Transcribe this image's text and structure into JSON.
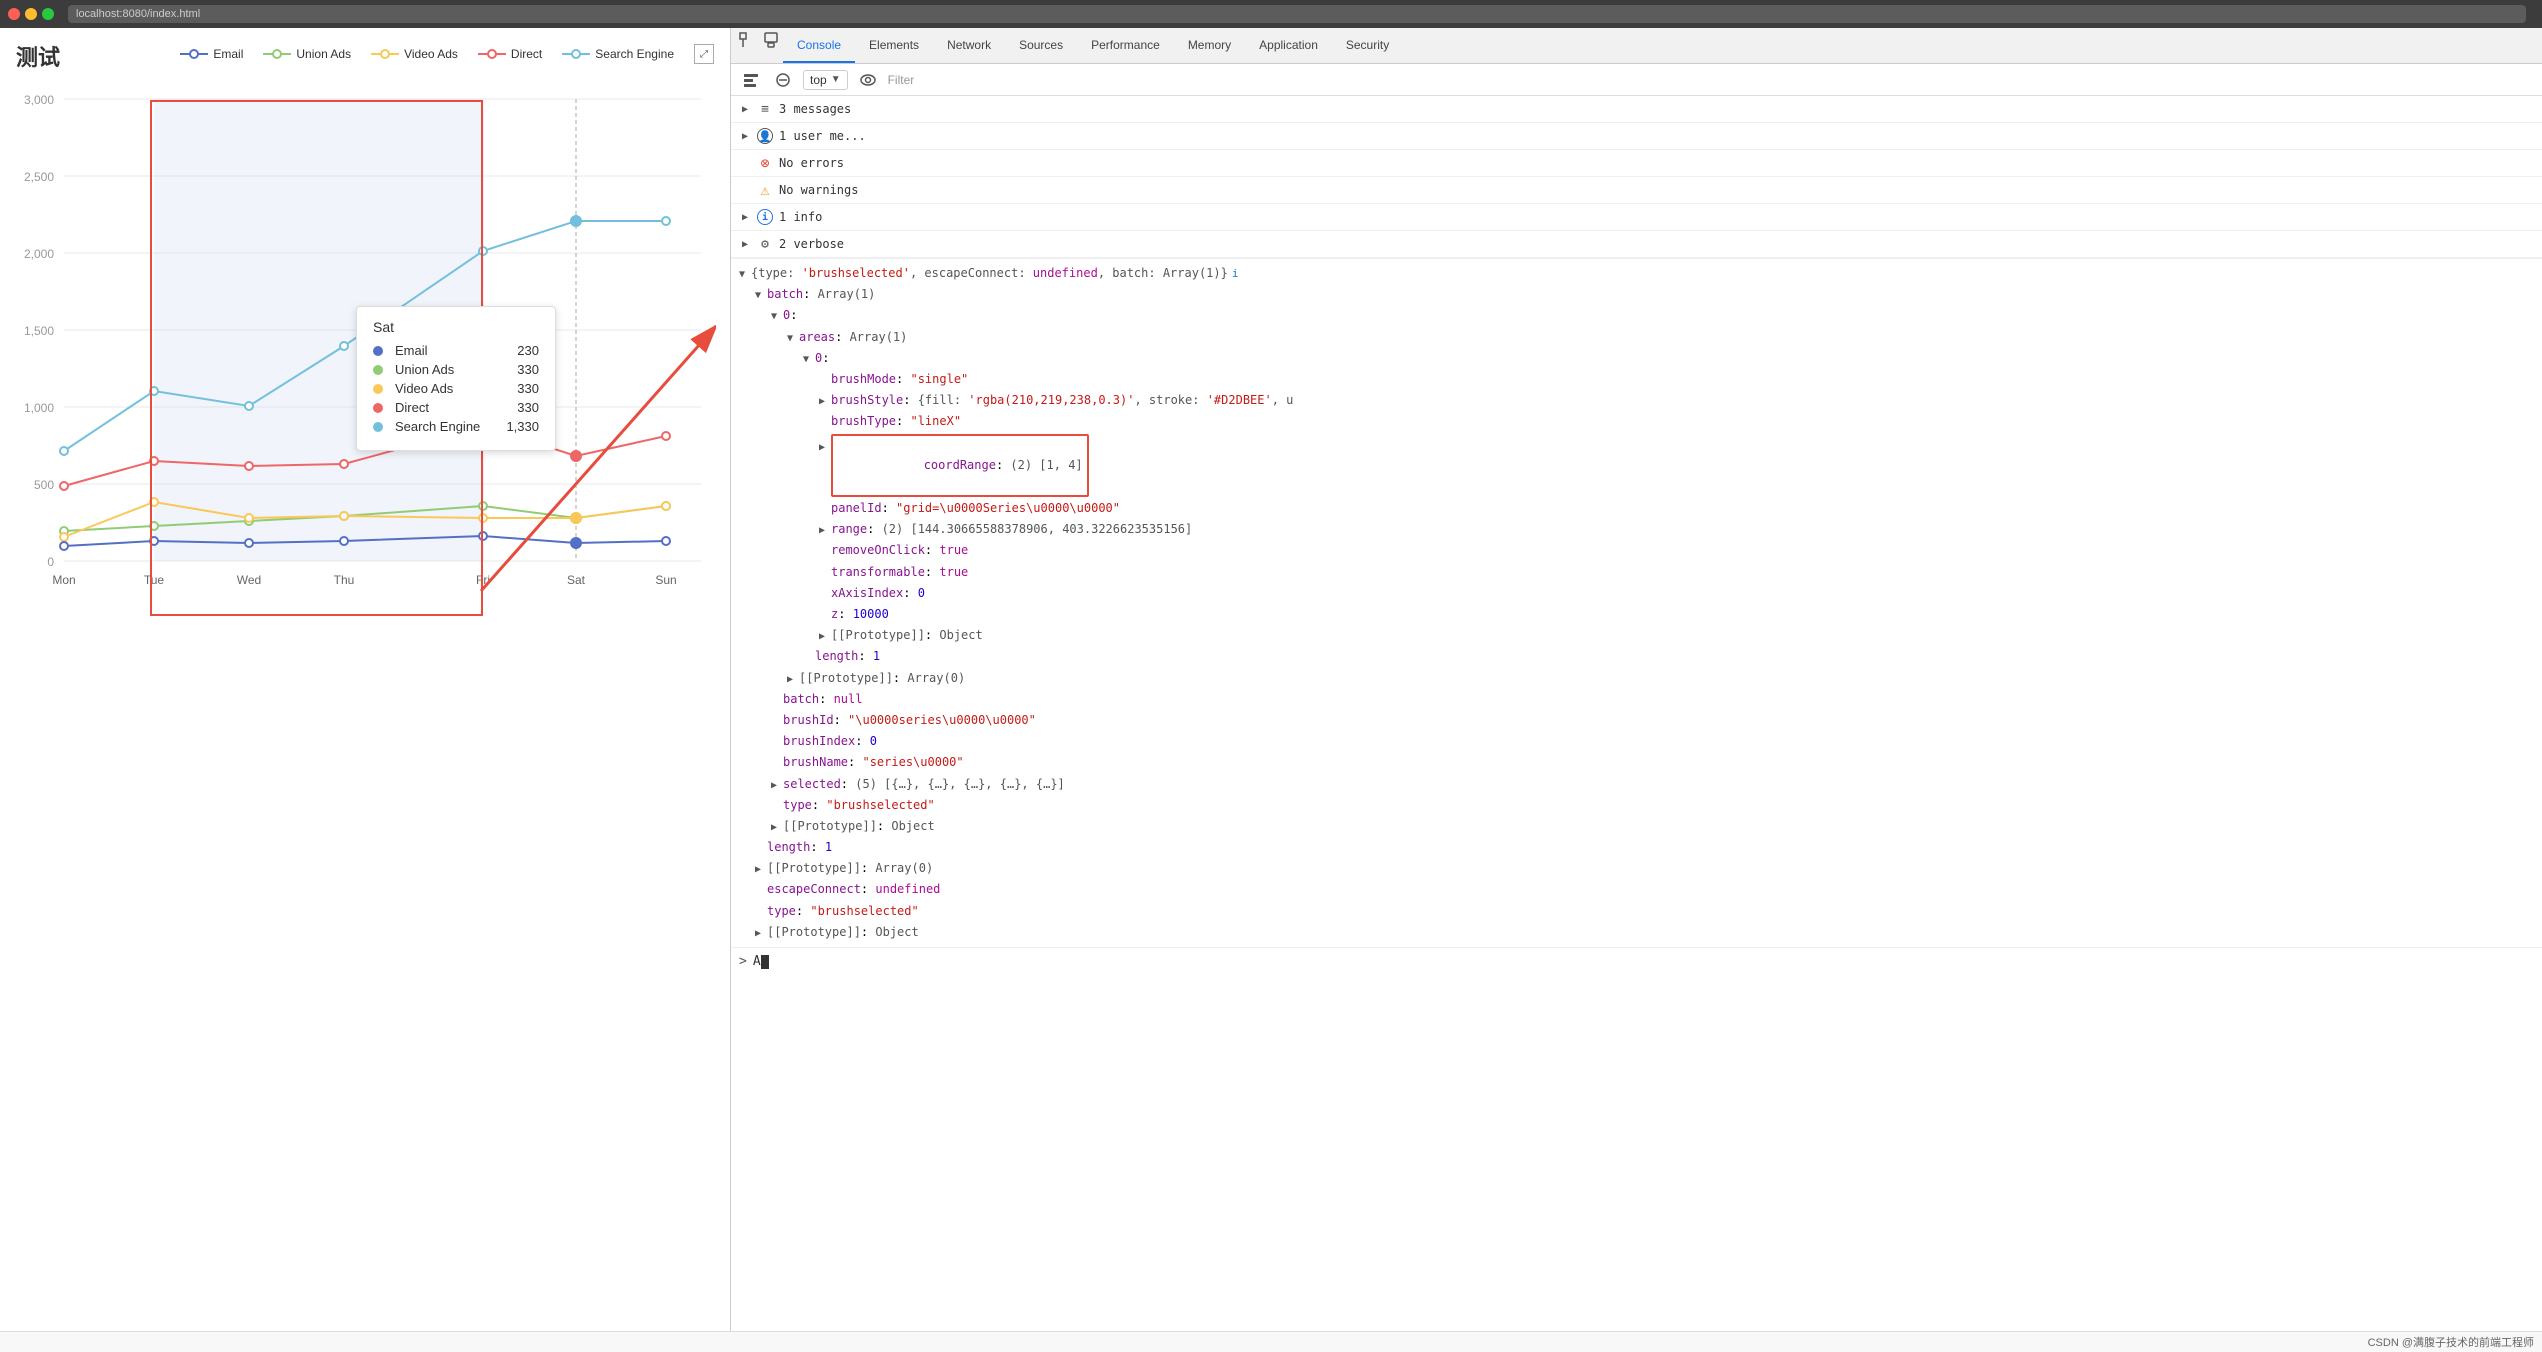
{
  "browser": {
    "url": "localhost:8080/index.html",
    "dots": [
      "#ff5f57",
      "#febc2e",
      "#28c840"
    ]
  },
  "chart": {
    "title": "测试",
    "legend": [
      {
        "label": "Email",
        "color": "#5470c6"
      },
      {
        "label": "Union Ads",
        "color": "#91cc75"
      },
      {
        "label": "Video Ads",
        "color": "#fac858"
      },
      {
        "label": "Direct",
        "color": "#ee6666"
      },
      {
        "label": "Search Engine",
        "color": "#73c0de"
      }
    ],
    "yAxis": [
      "3,000",
      "2,500",
      "2,000",
      "1,500",
      "1,000",
      "500",
      "0"
    ],
    "xAxis": [
      "Mon",
      "Tue",
      "Wed",
      "Thu",
      "Fri",
      "Sat",
      "Sun"
    ],
    "tooltip": {
      "title": "Sat",
      "rows": [
        {
          "label": "Email",
          "color": "#5470c6",
          "value": "230"
        },
        {
          "label": "Union Ads",
          "color": "#91cc75",
          "value": "330"
        },
        {
          "label": "Video Ads",
          "color": "#fac858",
          "value": "330"
        },
        {
          "label": "Direct",
          "color": "#ee6666",
          "value": "330"
        },
        {
          "label": "Search Engine",
          "color": "#73c0de",
          "value": "1,330"
        }
      ]
    }
  },
  "devtools": {
    "tabs": [
      "Console",
      "Elements",
      "Network",
      "Sources",
      "Performance",
      "Memory",
      "Application",
      "Security"
    ],
    "active_tab": "Console",
    "toolbar": {
      "top_label": "top",
      "filter_placeholder": "Filter"
    },
    "messages": [
      {
        "type": "list",
        "text": "3 messages",
        "icon": "list"
      },
      {
        "type": "user",
        "text": "1 user me...",
        "icon": "user"
      },
      {
        "type": "error",
        "text": "No errors",
        "icon": "error"
      },
      {
        "type": "warning",
        "text": "No warnings",
        "icon": "warning"
      },
      {
        "type": "info",
        "text": "1 info",
        "icon": "info"
      },
      {
        "type": "verbose",
        "text": "2 verbose",
        "icon": "verbose"
      }
    ],
    "tree": {
      "root": "{type: 'brushselected', escapeConnect: undefined, batch: Array(1)}",
      "root_info": "i",
      "lines": [
        {
          "indent": 1,
          "expand": "open",
          "key": "batch",
          "val": "Array(1)",
          "val_type": "special"
        },
        {
          "indent": 2,
          "expand": "open",
          "key": "0",
          "val": "",
          "val_type": ""
        },
        {
          "indent": 3,
          "expand": "open",
          "key": "areas",
          "val": "Array(1)",
          "val_type": "special"
        },
        {
          "indent": 4,
          "expand": "open",
          "key": "0",
          "val": "",
          "val_type": ""
        },
        {
          "indent": 5,
          "expand": "none",
          "key": "brushMode",
          "val": "\"single\"",
          "val_type": "string",
          "colon": true
        },
        {
          "indent": 5,
          "expand": "closed",
          "key": "brushStyle",
          "val": "{fill: 'rgba(210,219,238,0.3)', stroke: '#D2DBEE', u",
          "val_type": "special",
          "colon": true
        },
        {
          "indent": 5,
          "expand": "none",
          "key": "brushType",
          "val": "\"lineX\"",
          "val_type": "string",
          "colon": true
        },
        {
          "indent": 5,
          "expand": "open",
          "key": "coordRange",
          "val": "(2) [1, 4]",
          "val_type": "special",
          "colon": true,
          "highlighted": true
        },
        {
          "indent": 5,
          "expand": "none",
          "key": "panelId",
          "val": "\"grid=\\u0000Series\\u0000\\u0000\"",
          "val_type": "string",
          "colon": true
        },
        {
          "indent": 5,
          "expand": "closed",
          "key": "range",
          "val": "(2) [144.30665588378906, 403.3226623535156]",
          "val_type": "special",
          "colon": true
        },
        {
          "indent": 5,
          "expand": "none",
          "key": "removeOnClick",
          "val": "true",
          "val_type": "keyword",
          "colon": true
        },
        {
          "indent": 5,
          "expand": "none",
          "key": "transformable",
          "val": "true",
          "val_type": "keyword",
          "colon": true
        },
        {
          "indent": 5,
          "expand": "none",
          "key": "xAxisIndex",
          "val": "0",
          "val_type": "number",
          "colon": true
        },
        {
          "indent": 5,
          "expand": "none",
          "key": "z",
          "val": "10000",
          "val_type": "number",
          "colon": true
        },
        {
          "indent": 5,
          "expand": "closed",
          "key": "[[Prototype]]",
          "val": "Object",
          "val_type": "special",
          "colon": true
        },
        {
          "indent": 4,
          "expand": "none",
          "key": "length",
          "val": "1",
          "val_type": "number",
          "colon": true
        },
        {
          "indent": 3,
          "expand": "closed",
          "key": "[[Prototype]]",
          "val": "Array(0)",
          "val_type": "special",
          "colon": true
        },
        {
          "indent": 2,
          "expand": "none",
          "key": "batch",
          "val": "null",
          "val_type": "keyword",
          "colon": true
        },
        {
          "indent": 2,
          "expand": "none",
          "key": "brushId",
          "val": "\"\\u0000series\\u0000\\u0000\"",
          "val_type": "string",
          "colon": true
        },
        {
          "indent": 2,
          "expand": "none",
          "key": "brushIndex",
          "val": "0",
          "val_type": "number",
          "colon": true
        },
        {
          "indent": 2,
          "expand": "none",
          "key": "brushName",
          "val": "\"series\\u0000\"",
          "val_type": "string",
          "colon": true
        },
        {
          "indent": 2,
          "expand": "closed",
          "key": "selected",
          "val": "(5) [{…}, {…}, {…}, {…}, {…}]",
          "val_type": "special",
          "colon": true
        },
        {
          "indent": 2,
          "expand": "none",
          "key": "type",
          "val": "\"brushselected\"",
          "val_type": "string",
          "colon": true
        },
        {
          "indent": 2,
          "expand": "closed",
          "key": "[[Prototype]]",
          "val": "Object",
          "val_type": "special",
          "colon": true
        },
        {
          "indent": 1,
          "expand": "none",
          "key": "length",
          "val": "1",
          "val_type": "number",
          "colon": true
        },
        {
          "indent": 1,
          "expand": "closed",
          "key": "[[Prototype]]",
          "val": "Array(0)",
          "val_type": "special",
          "colon": true
        },
        {
          "indent": 0,
          "expand": "none",
          "key": "escapeConnect",
          "val": "undefined",
          "val_type": "keyword",
          "colon": true
        },
        {
          "indent": 0,
          "expand": "none",
          "key": "type",
          "val": "\"brushselected\"",
          "val_type": "string",
          "colon": true
        },
        {
          "indent": 0,
          "expand": "closed",
          "key": "[[Prototype]]",
          "val": "Object",
          "val_type": "special",
          "colon": true
        }
      ],
      "input_text": "A",
      "prompt": ">"
    }
  },
  "footer": {
    "text": "CSDN @满腹子技术的前端工程师"
  }
}
